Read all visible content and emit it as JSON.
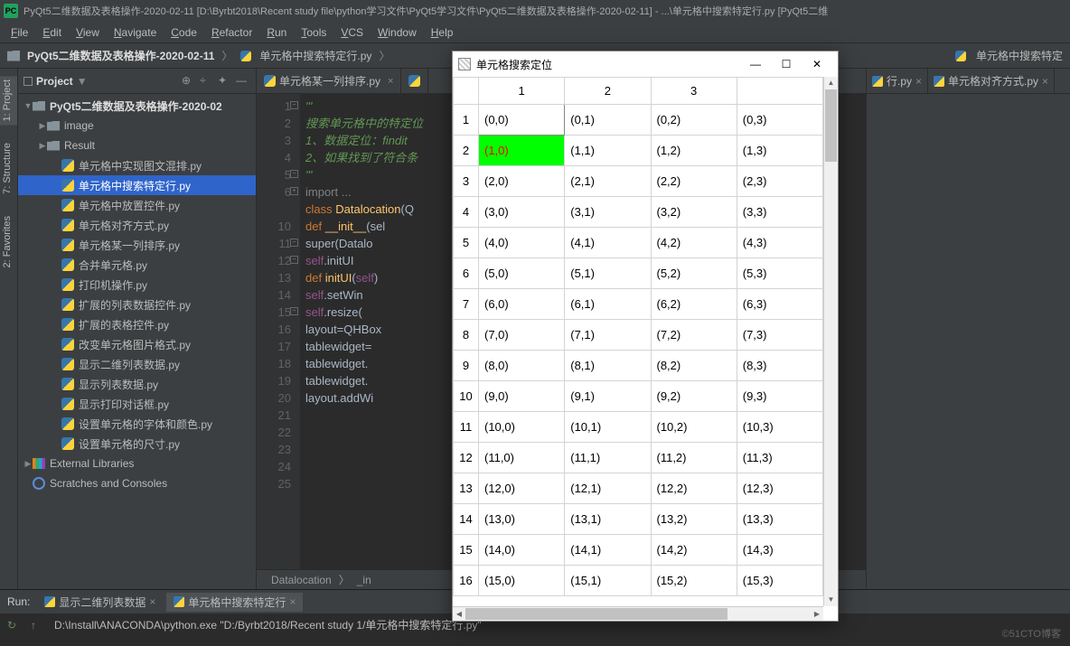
{
  "title": "PyQt5二维数据及表格操作-2020-02-11 [D:\\Byrbt2018\\Recent study file\\python学习文件\\PyQt5学习文件\\PyQt5二维数据及表格操作-2020-02-11] - ...\\单元格中搜索特定行.py [PyQt5二维",
  "menu": [
    "File",
    "Edit",
    "View",
    "Navigate",
    "Code",
    "Refactor",
    "Run",
    "Tools",
    "VCS",
    "Window",
    "Help"
  ],
  "nav": {
    "project": "PyQt5二维数据及表格操作-2020-02-11",
    "file": "单元格中搜索特定行.py"
  },
  "nav_right": {
    "file": "单元格中搜索特定"
  },
  "side_tabs": [
    "1: Project",
    "7: Structure",
    "2: Favorites"
  ],
  "project_panel_title": "Project",
  "tree": [
    {
      "lvl": 0,
      "type": "folder",
      "chev": "▼",
      "label": "PyQt5二维数据及表格操作-2020-02",
      "bold": true
    },
    {
      "lvl": 1,
      "type": "folder",
      "chev": "▶",
      "label": "image"
    },
    {
      "lvl": 1,
      "type": "folder",
      "chev": "▶",
      "label": "Result"
    },
    {
      "lvl": 2,
      "type": "py",
      "label": "单元格中实现图文混排.py"
    },
    {
      "lvl": 2,
      "type": "py",
      "label": "单元格中搜索特定行.py",
      "selected": true
    },
    {
      "lvl": 2,
      "type": "py",
      "label": "单元格中放置控件.py"
    },
    {
      "lvl": 2,
      "type": "py",
      "label": "单元格对齐方式.py"
    },
    {
      "lvl": 2,
      "type": "py",
      "label": "单元格某一列排序.py"
    },
    {
      "lvl": 2,
      "type": "py",
      "label": "合并单元格.py"
    },
    {
      "lvl": 2,
      "type": "py",
      "label": "打印机操作.py"
    },
    {
      "lvl": 2,
      "type": "py",
      "label": "扩展的列表数据控件.py"
    },
    {
      "lvl": 2,
      "type": "py",
      "label": "扩展的表格控件.py"
    },
    {
      "lvl": 2,
      "type": "py",
      "label": "改变单元格图片格式.py"
    },
    {
      "lvl": 2,
      "type": "py",
      "label": "显示二维列表数据.py"
    },
    {
      "lvl": 2,
      "type": "py",
      "label": "显示列表数据.py"
    },
    {
      "lvl": 2,
      "type": "py",
      "label": "显示打印对话框.py"
    },
    {
      "lvl": 2,
      "type": "py",
      "label": "设置单元格的字体和颜色.py"
    },
    {
      "lvl": 2,
      "type": "py",
      "label": "设置单元格的尺寸.py"
    },
    {
      "lvl": 0,
      "type": "lib",
      "chev": "▶",
      "label": "External Libraries"
    },
    {
      "lvl": 0,
      "type": "scratch",
      "label": "Scratches and Consoles"
    }
  ],
  "editor_tabs": [
    {
      "label": "单元格某一列排序.py",
      "close": true
    }
  ],
  "right_tabs_r1": [
    {
      "label": "行.py",
      "close": true
    },
    {
      "label": "单元格对齐方式.py",
      "close": true
    }
  ],
  "code": {
    "lines": [
      1,
      2,
      3,
      4,
      5,
      6,
      "",
      10,
      11,
      12,
      13,
      14,
      15,
      16,
      17,
      18,
      19,
      20,
      21,
      22,
      23,
      24,
      25
    ],
    "text": [
      {
        "cls": "d",
        "t": "'''"
      },
      {
        "cls": "d",
        "t": "搜索单元格中的特定位"
      },
      {
        "cls": "d",
        "t": "1、数据定位：findit"
      },
      {
        "cls": "d",
        "t": "2、如果找到了符合条"
      },
      {
        "cls": "d",
        "t": "'''"
      },
      {
        "cls": "c",
        "t": "import ..."
      },
      {
        "cls": "",
        "t": ""
      },
      {
        "cls": "",
        "t": ""
      },
      {
        "html": "<span class='k'>class</span> <span class='f'>Datalocation</span>(Q"
      },
      {
        "html": "    <span class='k'>def</span> <span class='f'>__init__</span>(sel"
      },
      {
        "html": "        super(Datalo"
      },
      {
        "html": "        <span class='s'>self</span>.initUI"
      },
      {
        "html": "    <span class='k'>def</span> <span class='f'>initUI</span>(<span class='s'>self</span>)"
      },
      {
        "html": "        <span class='s'>self</span>.setWin"
      },
      {
        "html": "        <span class='s'>self</span>.resize("
      },
      {
        "cls": "",
        "t": ""
      },
      {
        "html": "        layout=QHBox"
      },
      {
        "html": "        tablewidget="
      },
      {
        "html": "        tablewidget."
      },
      {
        "html": "        tablewidget."
      },
      {
        "cls": "",
        "t": ""
      },
      {
        "html": "        layout.addWi"
      },
      {
        "cls": "",
        "t": ""
      }
    ]
  },
  "breadcrumb": [
    "Datalocation",
    "_in"
  ],
  "run": {
    "label": "Run:",
    "tabs": [
      {
        "label": "显示二维列表数据",
        "close": true
      },
      {
        "label": "单元格中搜索特定行",
        "close": true,
        "active": true
      }
    ],
    "output": "D:\\Install\\ANACONDA\\python.exe \"D:/Byrbt2018/Recent study                                                                 1/单元格中搜索特定行.py\""
  },
  "dialog": {
    "title": "单元格搜索定位",
    "headers": [
      "1",
      "2",
      "3",
      ""
    ],
    "row_headers": [
      1,
      2,
      3,
      4,
      5,
      6,
      7,
      8,
      9,
      10,
      11,
      12,
      13,
      14,
      15,
      16
    ],
    "cells": [
      [
        "(0,0)",
        "(0,1)",
        "(0,2)",
        "(0,3)"
      ],
      [
        "(1,0)",
        "(1,1)",
        "(1,2)",
        "(1,3)"
      ],
      [
        "(2,0)",
        "(2,1)",
        "(2,2)",
        "(2,3)"
      ],
      [
        "(3,0)",
        "(3,1)",
        "(3,2)",
        "(3,3)"
      ],
      [
        "(4,0)",
        "(4,1)",
        "(4,2)",
        "(4,3)"
      ],
      [
        "(5,0)",
        "(5,1)",
        "(5,2)",
        "(5,3)"
      ],
      [
        "(6,0)",
        "(6,1)",
        "(6,2)",
        "(6,3)"
      ],
      [
        "(7,0)",
        "(7,1)",
        "(7,2)",
        "(7,3)"
      ],
      [
        "(8,0)",
        "(8,1)",
        "(8,2)",
        "(8,3)"
      ],
      [
        "(9,0)",
        "(9,1)",
        "(9,2)",
        "(9,3)"
      ],
      [
        "(10,0)",
        "(10,1)",
        "(10,2)",
        "(10,3)"
      ],
      [
        "(11,0)",
        "(11,1)",
        "(11,2)",
        "(11,3)"
      ],
      [
        "(12,0)",
        "(12,1)",
        "(12,2)",
        "(12,3)"
      ],
      [
        "(13,0)",
        "(13,1)",
        "(13,2)",
        "(13,3)"
      ],
      [
        "(14,0)",
        "(14,1)",
        "(14,2)",
        "(14,3)"
      ],
      [
        "(15,0)",
        "(15,1)",
        "(15,2)",
        "(15,3)"
      ]
    ],
    "highlight": {
      "row": 1,
      "col": 0
    },
    "selected": {
      "row": 0,
      "col": 0
    }
  },
  "watermark": "©51CTO博客"
}
